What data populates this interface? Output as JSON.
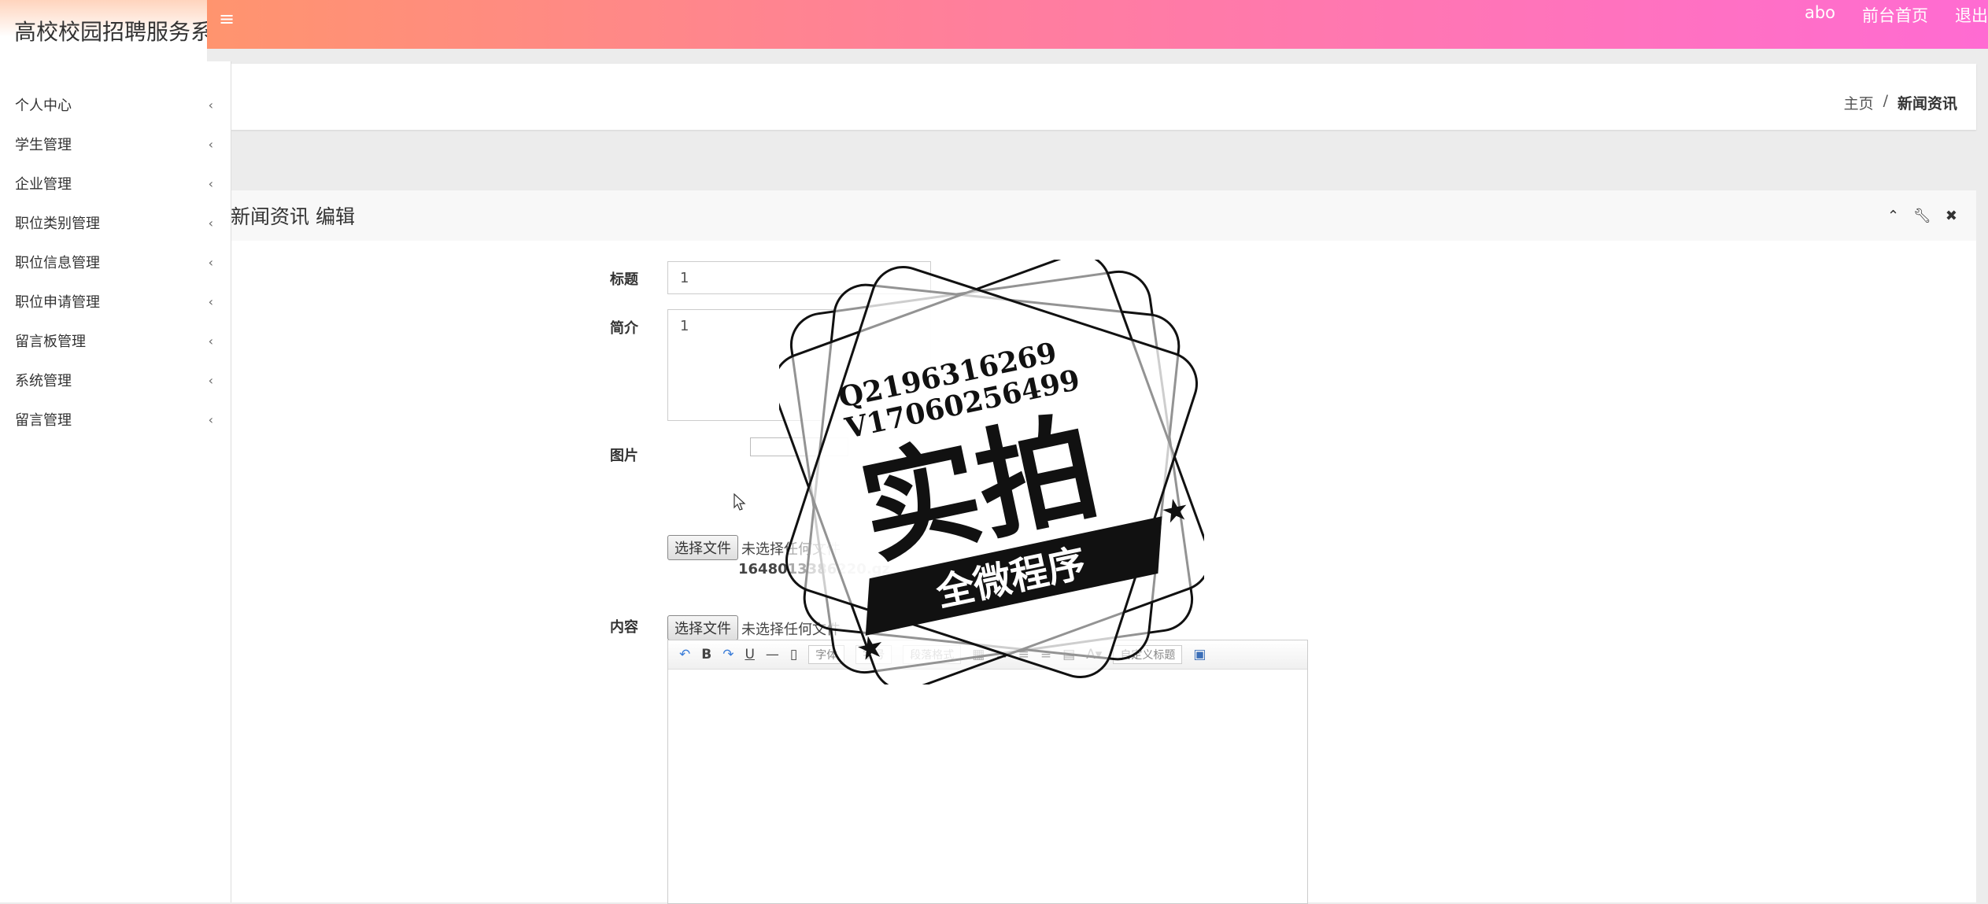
{
  "app": {
    "title": "高校校园招聘服务系"
  },
  "topbar": {
    "links": [
      "abo",
      "前台首页",
      "退出"
    ]
  },
  "sidebar": {
    "items": [
      {
        "label": "个人中心"
      },
      {
        "label": "学生管理"
      },
      {
        "label": "企业管理"
      },
      {
        "label": "职位类别管理"
      },
      {
        "label": "职位信息管理"
      },
      {
        "label": "职位申请管理"
      },
      {
        "label": "留言板管理"
      },
      {
        "label": "系统管理"
      },
      {
        "label": "留言管理"
      }
    ]
  },
  "breadcrumb": {
    "home": "主页",
    "sep": "/",
    "current": "新闻资讯"
  },
  "card": {
    "title": "新闻资讯 编辑"
  },
  "form": {
    "title_label": "标题",
    "title_value": "1",
    "intro_label": "简介",
    "intro_value": "1",
    "image_label": "图片",
    "file_button": "选择文件",
    "file_none": "未选择任何文件",
    "filename": "1648013386220.gz",
    "content_label": "内容",
    "content_file_button": "选择文件",
    "content_file_none": "未选择任何文件"
  },
  "editor": {
    "font_select": "字体",
    "size_select": "字号",
    "format_select": "段落格式",
    "custom_title": "自定义标题"
  },
  "watermark": {
    "line1": "Q2196316269",
    "line2": "V17060256499",
    "big": "实拍",
    "ribbon": "全微程序"
  },
  "colors": {
    "top_gradient_start": "#ff9a62",
    "top_gradient_end": "#ff6bd2"
  }
}
